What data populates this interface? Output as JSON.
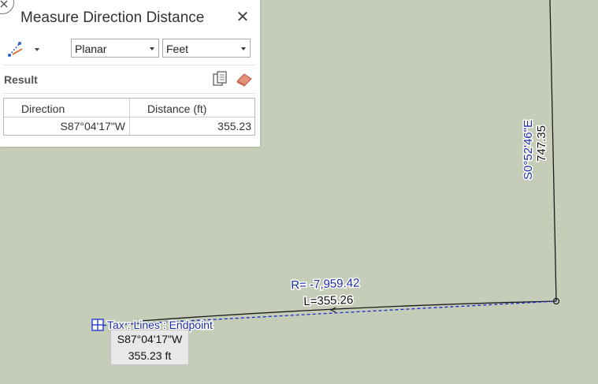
{
  "pane": {
    "title": "Measure Direction Distance",
    "close_glyph": "✕",
    "mode_select": "Planar",
    "unit_select": "Feet",
    "result_label": "Result",
    "columns": [
      "Direction",
      "Distance (ft)"
    ],
    "rows": [
      {
        "direction": "S87°04'17\"W",
        "distance": "355.23"
      }
    ]
  },
  "map": {
    "vertical_line_bearing": "S0°52'46\"E",
    "vertical_line_length": "747.35",
    "curve_radius": "R= -7,959.42",
    "curve_length": "L=355.26",
    "snap_label": "Tax : Lines : Endpoint",
    "line_color": "#1a1a1a",
    "measure_line_color": "#1a2ecc",
    "label_color_blue": "#1a2ea8",
    "background": "#c5cdb8"
  },
  "tooltip": {
    "direction": "S87°04'17\"W",
    "distance": "355.23 ft"
  }
}
